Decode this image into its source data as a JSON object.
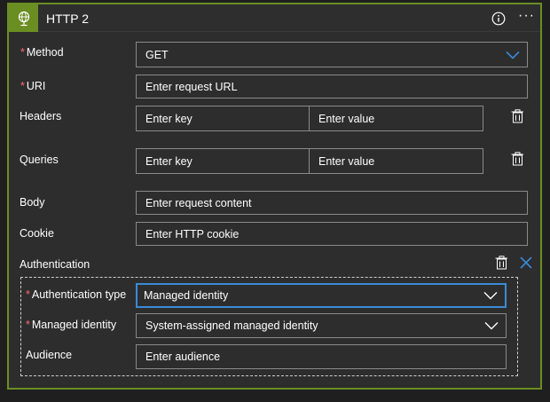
{
  "header": {
    "title": "HTTP 2",
    "icon": "globe-icon",
    "accent": "#6b8e23"
  },
  "fields": {
    "method": {
      "label": "Method",
      "value": "GET"
    },
    "uri": {
      "label": "URI",
      "placeholder": "Enter request URL"
    },
    "headers": {
      "label": "Headers",
      "key_placeholder": "Enter key",
      "value_placeholder": "Enter value"
    },
    "queries": {
      "label": "Queries",
      "key_placeholder": "Enter key",
      "value_placeholder": "Enter value"
    },
    "body": {
      "label": "Body",
      "placeholder": "Enter request content"
    },
    "cookie": {
      "label": "Cookie",
      "placeholder": "Enter HTTP cookie"
    }
  },
  "authentication": {
    "label": "Authentication",
    "type": {
      "label": "Authentication type",
      "value": "Managed identity"
    },
    "managed_identity": {
      "label": "Managed identity",
      "value": "System-assigned managed identity"
    },
    "audience": {
      "label": "Audience",
      "placeholder": "Enter audience"
    }
  },
  "required_marker": "*"
}
